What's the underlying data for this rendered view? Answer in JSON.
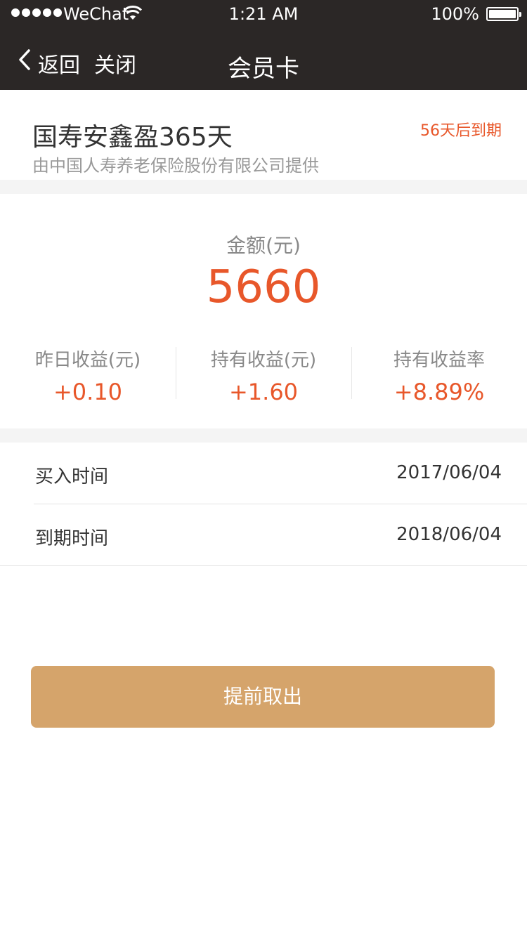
{
  "status_bar": {
    "carrier": "WeChat",
    "time": "1:21 AM",
    "battery": "100%"
  },
  "nav": {
    "back_label": "返回",
    "close_label": "关闭",
    "title": "会员卡"
  },
  "product": {
    "name": "国寿安鑫盈365天",
    "provider": "由中国人寿养老保险股份有限公司提供",
    "expiry": "56天后到期"
  },
  "amount": {
    "label": "金额(元)",
    "value": "5660"
  },
  "stats": [
    {
      "label": "昨日收益(元)",
      "value": "+0.10"
    },
    {
      "label": "持有收益(元)",
      "value": "+1.60"
    },
    {
      "label": "持有收益率",
      "value": "+8.89%"
    }
  ],
  "info": {
    "buy_time_label": "买入时间",
    "buy_time_value": "2017/06/04",
    "due_time_label": "到期时间",
    "due_time_value": "2018/06/04"
  },
  "action": {
    "withdraw_label": "提前取出"
  },
  "colors": {
    "header_bg": "#2b2726",
    "accent": "#e8572a",
    "button": "#d5a46b"
  }
}
